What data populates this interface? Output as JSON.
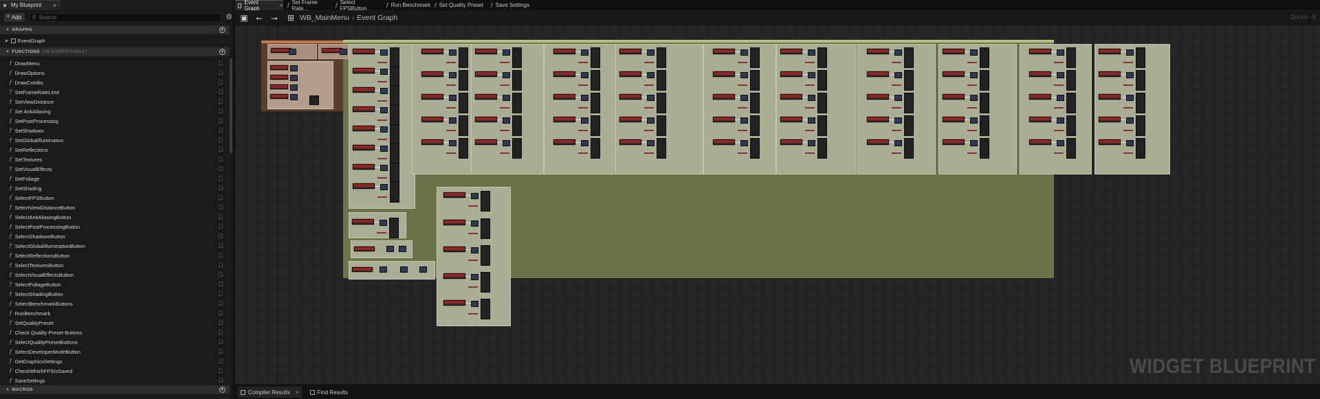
{
  "left_panel": {
    "tab_label": "My Blueprint",
    "add_label": "Add",
    "search_placeholder": "Search",
    "graphs": {
      "header": "GRAPHS",
      "item": "EventGraph"
    },
    "functions": {
      "header": "FUNCTIONS",
      "overridable": "(38 OVERRIDABLE)",
      "items": [
        "DrawMenu",
        "DrawOptions",
        "DrawCredits",
        "SetFrameRateLimit",
        "SetViewDistance",
        "Set AntiAliasing",
        "SetPostProcessing",
        "SetShadows",
        "SetGlobalIllumination",
        "SetReflections",
        "SetTextures",
        "SetVisualEffects",
        "SetFoliage",
        "SetShading",
        "SelectFPSButton",
        "SelectViewDistanceButton",
        "SelectAntiAliasingButton",
        "SelectPostProcessingButton",
        "SelectShadowsButton",
        "SelectGlobalIlluminationButton",
        "SelectReflectionsButton",
        "SelectTexturesButton",
        "SelectVisualEffectsButton",
        "SelectFoliageButton",
        "SelectShadingButton",
        "SelectBenchmarkButtons",
        "RunBenchmark",
        "SetQualityPreset",
        "Check Quality Preset Buttons",
        "SelectQualityPresetButtons",
        "SelectDeveloperModeButton",
        "GetGraphicsSettings",
        "CheckWhichFPSIsSaved",
        "SaveSettings"
      ]
    },
    "macros": {
      "header": "MACROS"
    }
  },
  "tabs": [
    {
      "label": "Event Graph",
      "active": true,
      "type": "graph"
    },
    {
      "label": "Set Frame Rate...",
      "active": false,
      "type": "function"
    },
    {
      "label": "Select FPSButton",
      "active": false,
      "type": "function"
    },
    {
      "label": "Run Benchmark",
      "active": false,
      "type": "function"
    },
    {
      "label": "Set Quality Preset",
      "active": false,
      "type": "function"
    },
    {
      "label": "Save Settings",
      "active": false,
      "type": "function"
    }
  ],
  "breadcrumb": {
    "blueprint": "WB_MainMenu",
    "graph": "Event Graph"
  },
  "zoom_label": "Zoom -8",
  "watermark": "WIDGET BLUEPRINT",
  "bottom_tabs": [
    {
      "label": "Compiler Results",
      "active": true
    },
    {
      "label": "Find Results",
      "active": false
    }
  ],
  "colors": {
    "comment_orange": "#5a3d2c",
    "comment_green": "#6b7448",
    "node_header_red": "#9e2020",
    "add_plus_green": "#3fb54a"
  }
}
